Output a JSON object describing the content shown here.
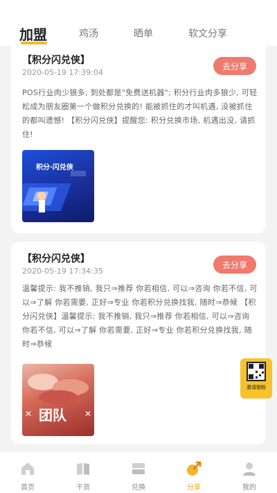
{
  "top_tabs": [
    {
      "label": "加盟",
      "active": true
    },
    {
      "label": "鸡汤",
      "active": false
    },
    {
      "label": "晒单",
      "active": false
    },
    {
      "label": "软文分享",
      "active": false
    }
  ],
  "posts": [
    {
      "title": "【积分闪兑侠】",
      "time": "2020-05-19 17:39:04",
      "share_label": "去分享",
      "body": "POS行业肉少狼多, 到处都是\"免费送机器\"; 积分行业肉多狼少, 可轻松成为朋友圈第一个做积分兑换的! 能被抓住的才叫机遇, 没被抓住的都叫遗憾! 【积分闪兑侠】提醒您: 积分兑换市场, 机遇出没, 请抓住!",
      "image_text": "积分·闪兑侠"
    },
    {
      "title": "【积分闪兑侠】",
      "time": "2020-05-19 17:34:35",
      "share_label": "去分享",
      "body": "温馨提示: 我不推销, 我只⇒推荐 你若相信, 可以⇒咨询 你若不信, 可以⇒了解 你若需要, 正好⇒专业 你若积分兑换找我, 随时⇒恭候 【积分闪兑侠】温馨提示: 我不推销, 我只⇒推荐 你若相信, 可以⇒咨询 你若不信, 可以⇒了解 你若需要, 正好⇒专业 你若积分兑换找我, 随时⇒恭候",
      "image_text": "团队"
    }
  ],
  "floating_button": {
    "label": "邀请锁粉"
  },
  "bottom_nav": [
    {
      "label": "首页",
      "icon": "home-icon",
      "active": false
    },
    {
      "label": "干货",
      "icon": "book-icon",
      "active": false
    },
    {
      "label": "兑换",
      "icon": "exchange-icon",
      "active": false
    },
    {
      "label": "分享",
      "icon": "share-icon",
      "active": true
    },
    {
      "label": "我的",
      "icon": "profile-icon",
      "active": false
    }
  ],
  "colors": {
    "accent": "#f2b830",
    "share_button": "#ef7a6d",
    "nav_active": "#f0a020"
  }
}
